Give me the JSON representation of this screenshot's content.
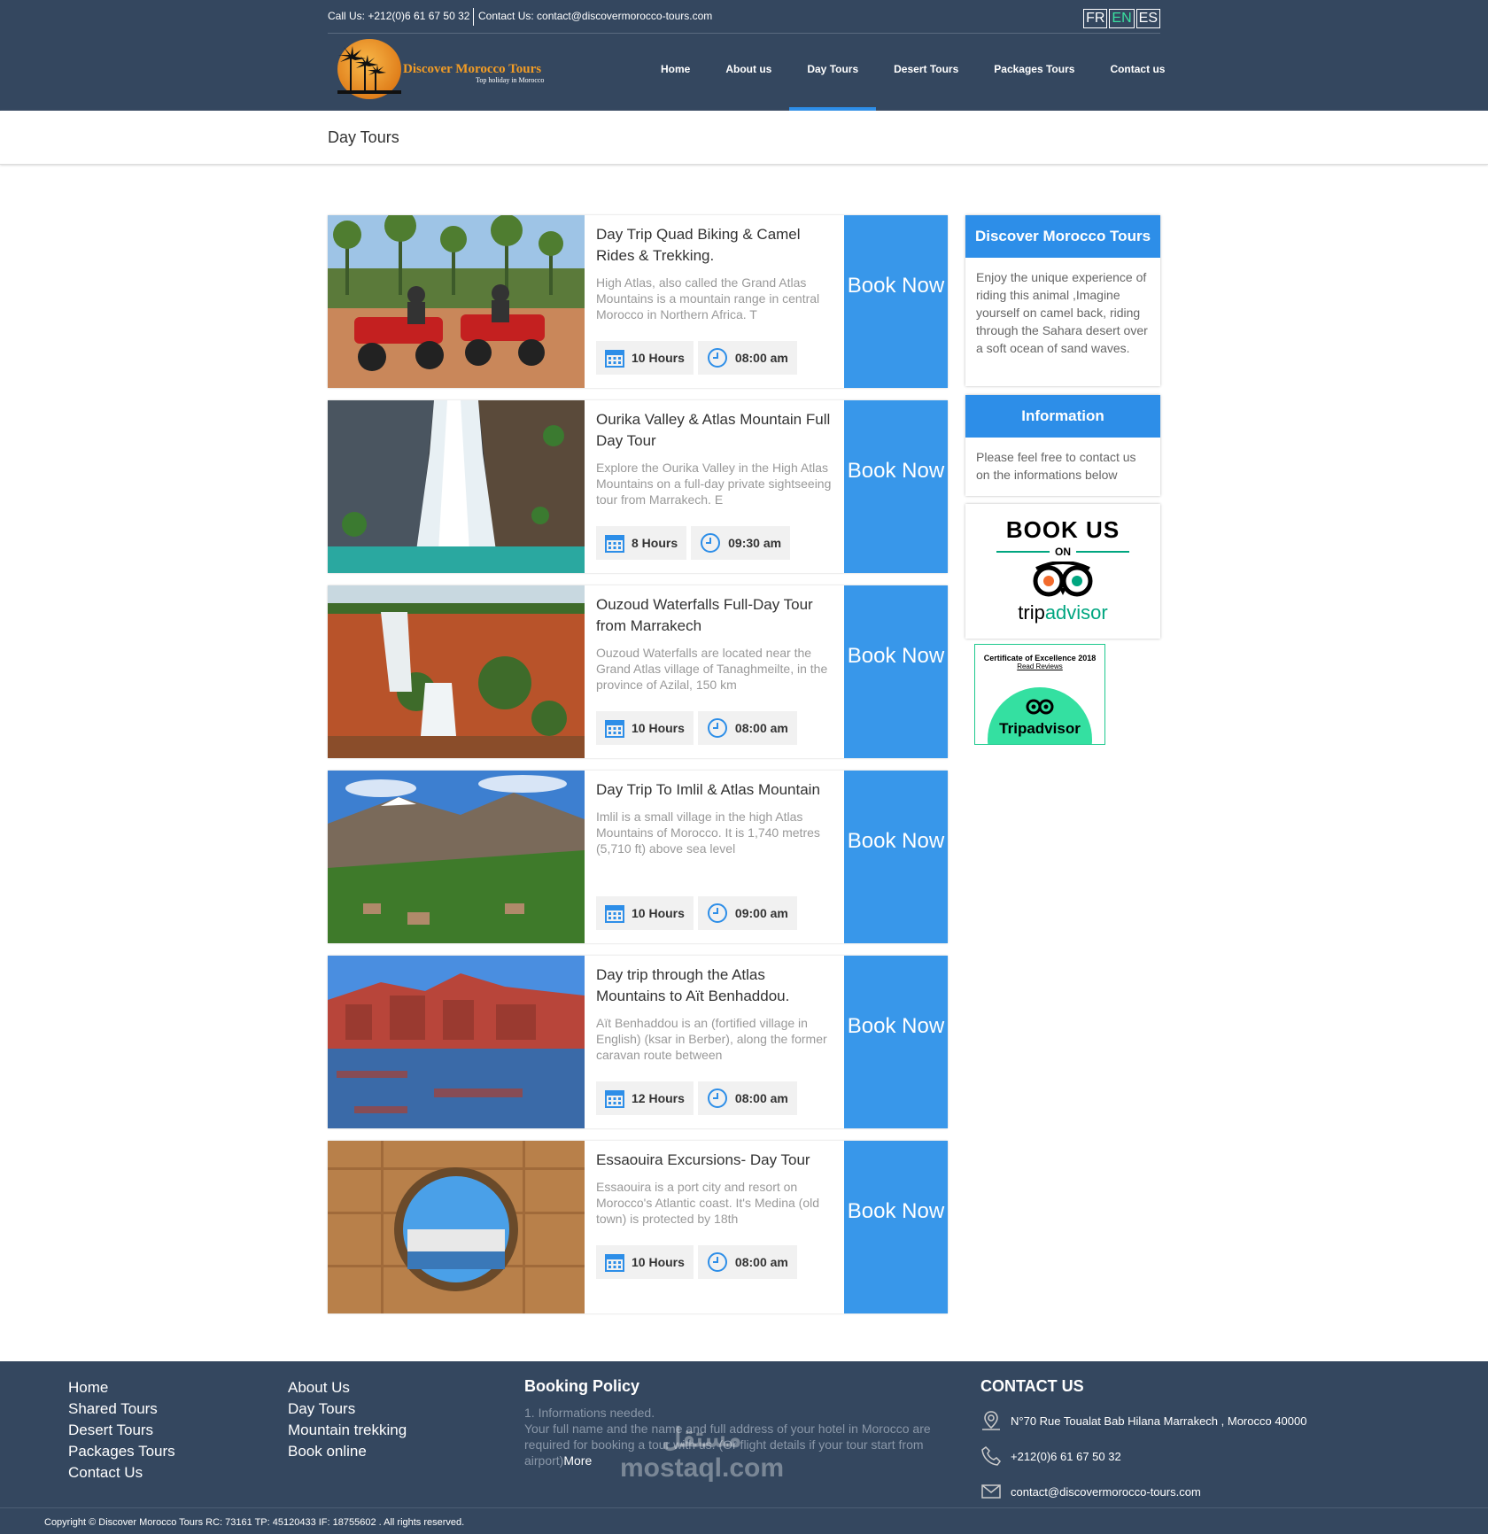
{
  "topbar": {
    "call": "Call Us: +212(0)6 61 67 50 32",
    "contact": "Contact Us: contact@discovermorocco-tours.com",
    "langs": [
      "FR",
      "EN",
      "ES"
    ]
  },
  "logo": {
    "name": "Discover Morocco Tours",
    "tagline": "Top holiday in Morocco"
  },
  "nav": [
    "Home",
    "About us",
    "Day Tours",
    "Desert Tours",
    "Packages Tours",
    "Contact us"
  ],
  "page_title": "Day Tours",
  "tours": [
    {
      "title": "Day Trip Quad Biking & Camel Rides & Trekking.",
      "desc": "High Atlas, also called the Grand Atlas Mountains is a mountain range in central Morocco in Northern Africa. T",
      "duration": "10 Hours",
      "time": "08:00 am",
      "book": "Book Now"
    },
    {
      "title": "Ourika Valley & Atlas Mountain Full Day Tour",
      "desc": "Explore the Ourika Valley in the High Atlas Mountains on a full-day private sightseeing tour from Marrakech. E",
      "duration": "8 Hours",
      "time": "09:30 am",
      "book": "Book Now"
    },
    {
      "title": "Ouzoud Waterfalls Full-Day Tour from Marrakech",
      "desc": "Ouzoud Waterfalls are located near the Grand Atlas village of Tanaghmeilte, in the province of Azilal, 150 km",
      "duration": "10 Hours",
      "time": "08:00 am",
      "book": "Book Now"
    },
    {
      "title": "Day Trip To Imlil & Atlas Mountain",
      "desc": "Imlil is a small village in the high Atlas Mountains of Morocco. It is 1,740 metres (5,710 ft) above sea level",
      "duration": "10 Hours",
      "time": "09:00 am",
      "book": "Book Now"
    },
    {
      "title": "Day trip through the Atlas Mountains to Aït Benhaddou.",
      "desc": "Aït Benhaddou is an (fortified village in English) (ksar in Berber), along the former caravan route between",
      "duration": "12 Hours",
      "time": "08:00 am",
      "book": "Book Now"
    },
    {
      "title": "Essaouira Excursions- Day Tour",
      "desc": "Essaouira is a port city and resort on Morocco's Atlantic coast. It's Medina (old town) is protected by 18th",
      "duration": "10 Hours",
      "time": "08:00 am",
      "book": "Book Now"
    }
  ],
  "sidebar": {
    "box1": {
      "title": "Discover Morocco Tours",
      "text": "Enjoy the unique experience of riding this animal ,Imagine yourself on camel back, riding through the Sahara desert over a soft ocean of sand waves."
    },
    "box2": {
      "title": "Information",
      "text": "Please feel free to contact us on the informations below"
    },
    "tripadvisor": {
      "book": "BOOK US",
      "on": "ON",
      "brand_trip": "trip",
      "brand_advisor": "advisor"
    },
    "certificate": {
      "title": "Certificate of Excellence 2018",
      "link": "Read Reviews",
      "brand": "Tripadvisor"
    }
  },
  "footer": {
    "col1": [
      "Home",
      "Shared Tours",
      "Desert Tours",
      "Packages Tours",
      "Contact Us"
    ],
    "col2": [
      "About Us",
      "Day Tours",
      "Mountain trekking",
      "Book online"
    ],
    "policy": {
      "title": "Booking Policy",
      "text": "1. Informations needed.\nYour full name and the name and full address of your hotel in Morocco are required for booking a tour with us. (Or flight details if your tour start from airport)",
      "more": "More"
    },
    "contact": {
      "title": "CONTACT US",
      "address": "N°70 Rue Toualat Bab Hilana Marrakech , Morocco 40000",
      "phone": "+212(0)6 61 67 50 32",
      "email": "contact@discovermorocco-tours.com"
    },
    "copyright": "Copyright © Discover Morocco Tours RC: 73161 TP: 45120433 IF: 18755602 . All rights reserved.",
    "watermark": "مستقل\nmostaql.com"
  },
  "colors": {
    "header": "#34475f",
    "accent": "#3897ea",
    "lang_active": "#3ae0a0"
  }
}
